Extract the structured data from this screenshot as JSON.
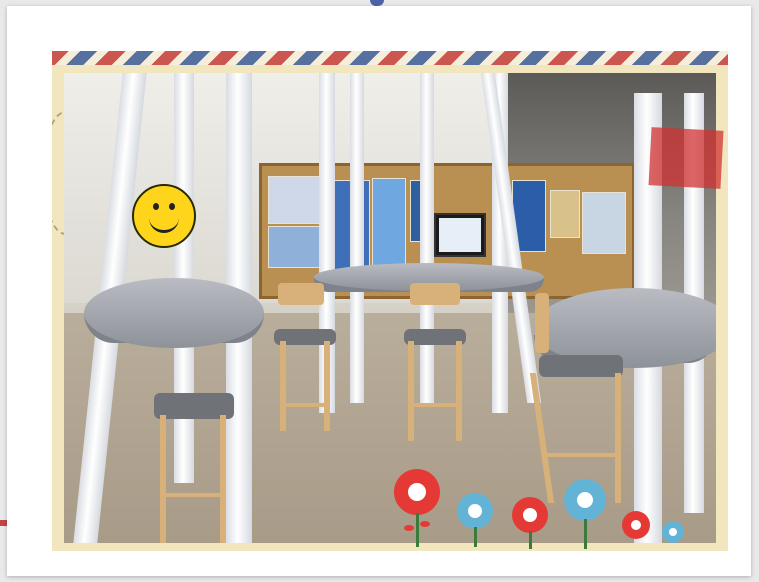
{
  "image": {
    "description_tags": [
      "smiley-sticker",
      "tables",
      "stools",
      "bulletin-board",
      "flowers"
    ],
    "colors": {
      "card_bg": "#ffffff",
      "page_bg": "#e9e9e9",
      "frame_bg": "#f1e6bd",
      "table_gray": "#9ea2a9",
      "stool_wood": "#d8b07a",
      "smiley_yellow": "#ffd51c",
      "flower_red": "#e53935",
      "flower_blue": "#62b3d6"
    },
    "stickers": [
      {
        "name": "smiley-face-sticker"
      },
      {
        "name": "parcel-stamp-sticker"
      },
      {
        "name": "flower-stickers"
      }
    ]
  }
}
